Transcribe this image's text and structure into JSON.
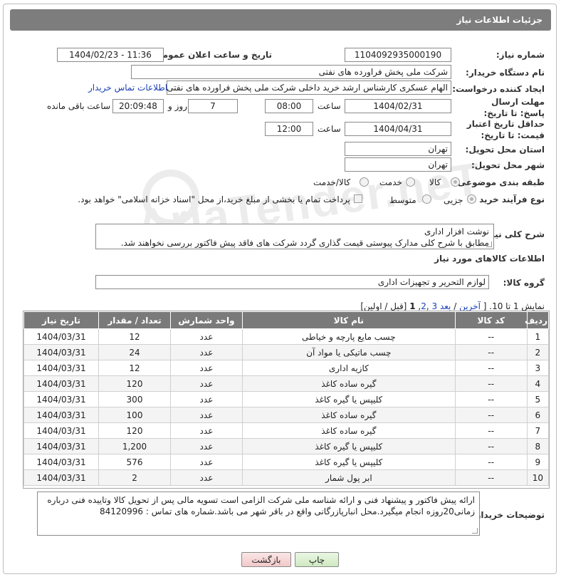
{
  "header": {
    "title": "جزئیات اطلاعات نیاز"
  },
  "watermark": {
    "text": "AriaTender.neT"
  },
  "fields": {
    "need_number_label": "شماره نیاز:",
    "need_number": "1104092935000190",
    "announce_label": "تاریخ و ساعت اعلان عمومی:",
    "announce_value": "1404/02/23 - 11:36",
    "buyer_org_label": "نام دستگاه خریدار:",
    "buyer_org": "شرکت ملی پخش فراورده های نفتی",
    "creator_label": "ایجاد کننده درخواست:",
    "creator": "الهام عسکری کارشناس ارشد خرید داخلی شرکت ملی پخش فراورده های نفتی",
    "contact_link": "اطلاعات تماس خریدار",
    "deadline_label": "مهلت ارسال پاسخ: تا تاریخ:",
    "deadline_date": "1404/02/31",
    "time_word": "ساعت",
    "deadline_time": "08:00",
    "days_count": "7",
    "days_word": "روز و",
    "remaining_time": "20:09:48",
    "remaining_word": "ساعت باقی مانده",
    "price_validity_label": "حداقل تاریخ اعتبار قیمت: تا تاریخ:",
    "price_validity_date": "1404/04/31",
    "price_validity_time": "12:00",
    "province_label": "استان محل تحویل:",
    "province": "تهران",
    "city_label": "شهر محل تحویل:",
    "city": "تهران",
    "category_label": "طبقه بندی موضوعی:",
    "category_options": [
      "کالا",
      "خدمت",
      "کالا/خدمت"
    ],
    "category_selected": "کالا",
    "process_label": "نوع فرآیند خرید :",
    "process_options": [
      "جزیی",
      "متوسط"
    ],
    "process_selected": "جزیی",
    "payment_note": "پرداخت تمام یا بخشی از مبلغ خرید،از محل \"اسناد خزانه اسلامی\" خواهد بود."
  },
  "description": {
    "label": "شرح کلی نیاز:",
    "line1": "نوشت افزار اداری",
    "line2": "مطابق با شرح کلی مدارک پیوستی قیمت گذاری گردد شرکت های فاقد پیش فاکتور بررسی نخواهند شد."
  },
  "goods_section_title": "اطلاعات کالاهای مورد نیاز",
  "goods_group": {
    "label": "گروه کالا:",
    "value": "لوازم التحریر و تجهیزات اداری"
  },
  "pagination": {
    "prefix": "نمایش 1 تا 10. [",
    "last": "آخرین",
    "next": "بعد",
    "p3": "3",
    "p2": "2",
    "p1": "1",
    "suffix": "[قبل / اولین]"
  },
  "table": {
    "headers": [
      "ردیف",
      "کد کالا",
      "نام کالا",
      "واحد شمارش",
      "تعداد / مقدار",
      "تاریخ نیاز"
    ],
    "rows": [
      [
        "1",
        "--",
        "چسب مایع پارچه و خیاطی",
        "عدد",
        "12",
        "1404/03/31"
      ],
      [
        "2",
        "--",
        "چسب ماتیکی یا مواد آن",
        "عدد",
        "24",
        "1404/03/31"
      ],
      [
        "3",
        "--",
        "کازیه اداری",
        "عدد",
        "12",
        "1404/03/31"
      ],
      [
        "4",
        "--",
        "گیره ساده کاغذ",
        "عدد",
        "120",
        "1404/03/31"
      ],
      [
        "5",
        "--",
        "کلیپس یا گیره کاغذ",
        "عدد",
        "300",
        "1404/03/31"
      ],
      [
        "6",
        "--",
        "گیره ساده کاغذ",
        "عدد",
        "100",
        "1404/03/31"
      ],
      [
        "7",
        "--",
        "گیره ساده کاغذ",
        "عدد",
        "120",
        "1404/03/31"
      ],
      [
        "8",
        "--",
        "کلیپس یا گیره کاغذ",
        "عدد",
        "1,200",
        "1404/03/31"
      ],
      [
        "9",
        "--",
        "کلیپس یا گیره کاغذ",
        "عدد",
        "576",
        "1404/03/31"
      ],
      [
        "10",
        "--",
        "ابر پول شمار",
        "عدد",
        "2",
        "1404/03/31"
      ]
    ]
  },
  "buyer_notes": {
    "label": "توضیحات خریدار:",
    "line1": "ارائه پیش فاکتور و پیشنهاد فنی و ارائه شناسه ملی شرکت الزامی است تسویه مالی پس از تحویل کالا وتاییده فنی درباره",
    "line2": "زمانی20روزه انجام میگیرد.محل انبارپازرگانی واقع در باقر شهر می باشد.شماره های تماس : 84120996"
  },
  "buttons": {
    "print": "چاپ",
    "back": "بازگشت"
  },
  "colors": {
    "header_bg": "#7d7d7d",
    "link": "#1a3fb5",
    "print_btn": "#d6efc8",
    "back_btn": "#f6d5d5"
  }
}
